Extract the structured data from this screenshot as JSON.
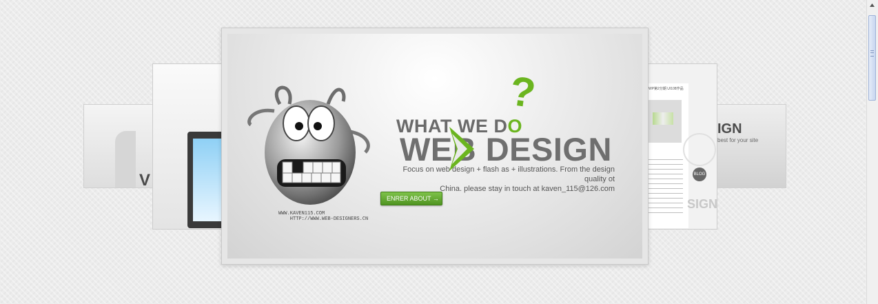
{
  "carousel": {
    "main_slide": {
      "heading_prefix": "WHAT WE D",
      "heading_o": "O",
      "title": "WEB DESIGN",
      "question_mark": "?",
      "description_line1": "Focus on web design + flash as + illustrations. From the design quality ot",
      "description_line2": "China. please stay in touch at kaven_115@126.com",
      "button_label": "ENRER ABOUT",
      "button_arrow": "→",
      "url_line1": "WWW.KAVEN115.COM",
      "url_line2": "    HTTP://WWW.WEB-DESIGNERS.CN"
    },
    "far_left_slide": {
      "mark": "V"
    },
    "far_right_slide": {
      "big_text": "IGN",
      "small_text": "best for your site"
    },
    "mid_right_slide": {
      "header": "WP第2分期 UI108作品",
      "badge": "BLOG",
      "bottom_text": "SIGN"
    }
  },
  "colors": {
    "accent": "#6bb51f",
    "heading_gray": "#6f6f6f",
    "button": "#5fa52e"
  },
  "icons": [
    "mascot-icon",
    "arrow-icon",
    "scroll-up-icon"
  ]
}
